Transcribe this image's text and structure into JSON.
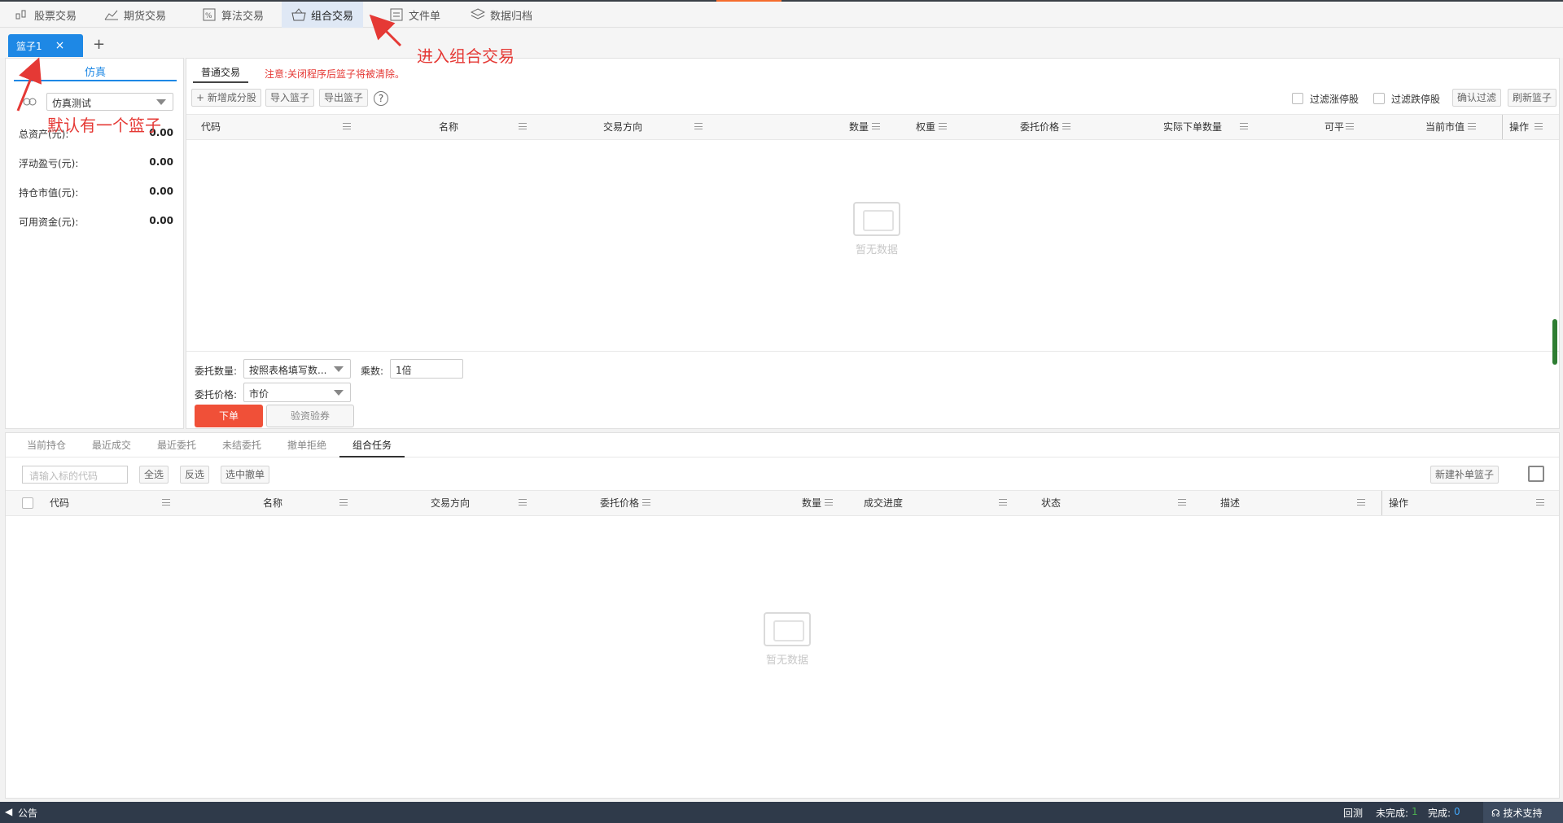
{
  "nav": [
    {
      "label": "股票交易",
      "icon": "stock-icon"
    },
    {
      "label": "期货交易",
      "icon": "futures-icon"
    },
    {
      "label": "算法交易",
      "icon": "algo-icon"
    },
    {
      "label": "组合交易",
      "icon": "basket-icon",
      "active": true
    },
    {
      "label": "文件单",
      "icon": "file-icon"
    },
    {
      "label": "数据归档",
      "icon": "layers-icon"
    }
  ],
  "basket_tab": {
    "label": "篮子1",
    "close": "×",
    "add": "+"
  },
  "left_panel": {
    "tab": "仿真",
    "account": "仿真测试",
    "stats": [
      {
        "label": "总资产(元):",
        "value": "0.00"
      },
      {
        "label": "浮动盈亏(元):",
        "value": "0.00"
      },
      {
        "label": "持仓市值(元):",
        "value": "0.00"
      },
      {
        "label": "可用资金(元):",
        "value": "0.00"
      }
    ]
  },
  "center": {
    "subtab": "普通交易",
    "notice": "注意:关闭程序后篮子将被清除。",
    "toolbar": {
      "add": "+ 新增成分股",
      "import": "导入篮子",
      "export": "导出篮子",
      "help": "?",
      "filter_up": "过滤涨停股",
      "filter_down": "过滤跌停股",
      "confirm_filter": "确认过滤",
      "refresh": "刷新篮子"
    },
    "columns": [
      "代码",
      "名称",
      "交易方向",
      "数量",
      "权重",
      "委托价格",
      "实际下单数量",
      "可平",
      "当前市值",
      "操作"
    ],
    "empty_text": "暂无数据",
    "form": {
      "qty_label": "委托数量:",
      "qty_value": "按照表格填写数...",
      "mult_label": "乘数:",
      "mult_value": "1倍",
      "price_label": "委托价格:",
      "price_value": "市价",
      "order_button": "下单",
      "check_button": "验资验券"
    }
  },
  "lower": {
    "tabs": [
      "当前持仓",
      "最近成交",
      "最近委托",
      "未结委托",
      "撤单拒绝",
      "组合任务"
    ],
    "active_tab": "组合任务",
    "search_placeholder": "请输入标的代码",
    "buttons": {
      "select_all": "全选",
      "invert": "反选",
      "cancel_selected": "选中撤单",
      "new_supplement": "新建补单篮子"
    },
    "columns": [
      "代码",
      "名称",
      "交易方向",
      "委托价格",
      "数量",
      "成交进度",
      "状态",
      "描述",
      "操作"
    ],
    "empty_text": "暂无数据"
  },
  "statusbar": {
    "notice": "公告",
    "backtest": "回测",
    "unfinished_label": "未完成:",
    "unfinished_value": "1",
    "finished_label": "完成:",
    "finished_value": "0",
    "support": "技术支持"
  },
  "annotations": {
    "enter": "进入组合交易",
    "default": "默认有一个篮子"
  },
  "colors": {
    "accent": "#1e88e5",
    "order_button": "#f05038",
    "annotation": "#e53935",
    "statusbar": "#2f3a4a"
  }
}
